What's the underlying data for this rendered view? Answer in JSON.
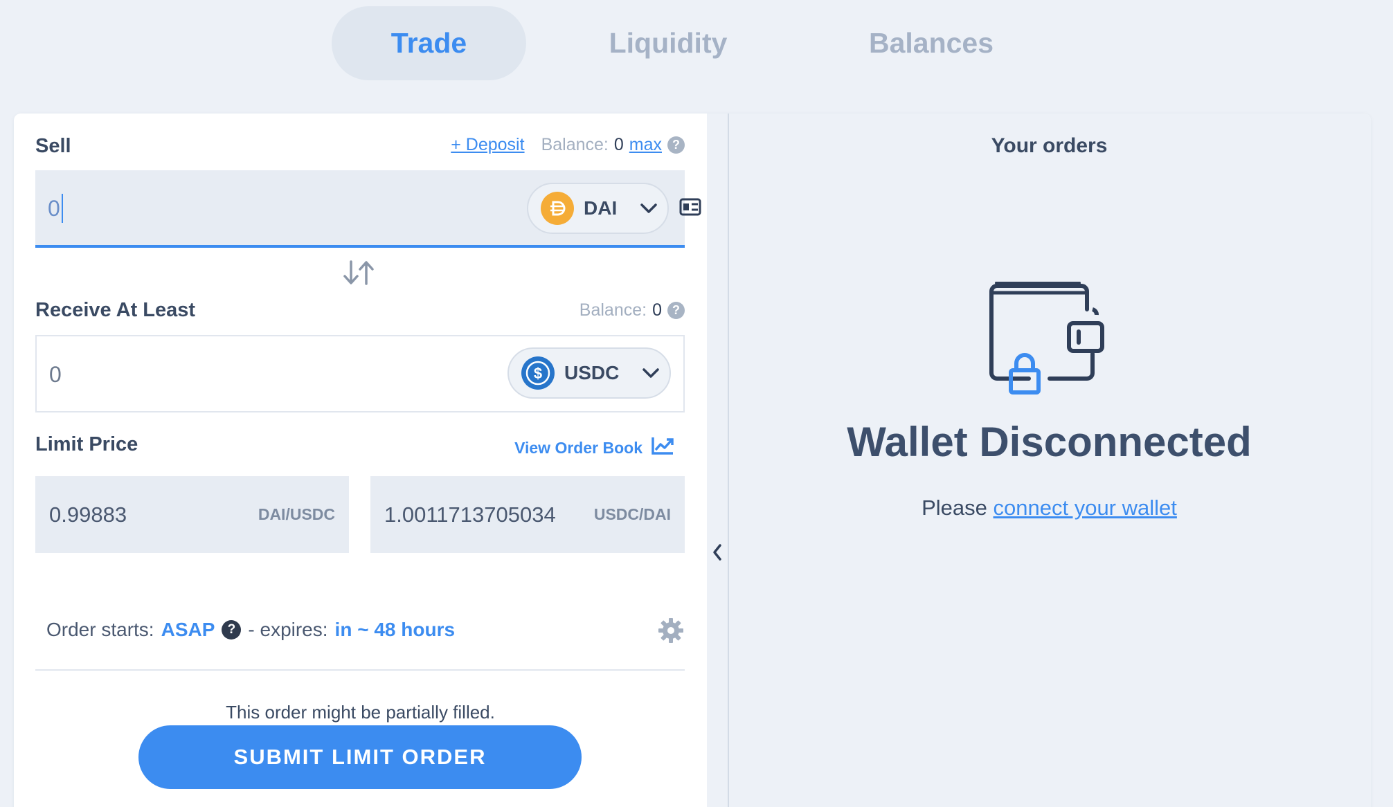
{
  "nav": {
    "tabs": [
      {
        "label": "Trade",
        "active": true
      },
      {
        "label": "Liquidity",
        "active": false
      },
      {
        "label": "Balances",
        "active": false
      }
    ]
  },
  "sell": {
    "label": "Sell",
    "deposit_link": "+ Deposit",
    "balance_label": "Balance:",
    "balance_value": "0",
    "max_link": "max",
    "amount_value": "0",
    "token": "DAI",
    "token_icon": "dai-icon"
  },
  "receive": {
    "label": "Receive At Least",
    "balance_label": "Balance:",
    "balance_value": "0",
    "amount_value": "0",
    "token": "USDC",
    "token_icon": "usdc-icon"
  },
  "limit": {
    "label": "Limit Price",
    "order_book_link": "View Order Book",
    "price_1": {
      "value": "0.99883",
      "unit": "DAI/USDC"
    },
    "price_2": {
      "value": "1.0011713705034",
      "unit": "USDC/DAI"
    }
  },
  "timing": {
    "starts_label": "Order starts:",
    "starts_value": "ASAP",
    "expires_label": "- expires:",
    "expires_value": "in ~ 48 hours"
  },
  "partial_note": "This order might be partially filled.",
  "submit_label": "SUBMIT LIMIT ORDER",
  "orders": {
    "title": "Your orders",
    "status_title": "Wallet Disconnected",
    "please_text": "Please",
    "connect_link": "connect your wallet"
  },
  "colors": {
    "accent": "#3c8cf0",
    "dai": "#f5ac37",
    "usdc": "#2775ca",
    "background": "#edf1f7"
  }
}
